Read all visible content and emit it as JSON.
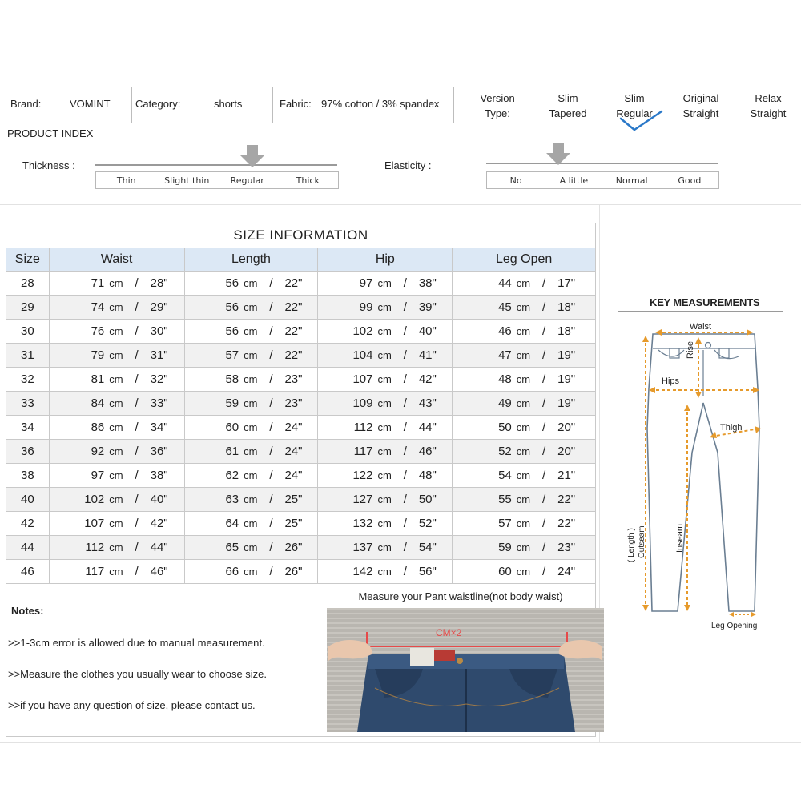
{
  "header": {
    "brand_label": "Brand:",
    "brand_value": "VOMINT",
    "category_label": "Category:",
    "category_value": "shorts",
    "fabric_label": "Fabric:",
    "fabric_value": "97% cotton / 3% spandex",
    "version_label_1": "Version",
    "version_label_2": "Type:",
    "versions": [
      {
        "line1": "Slim",
        "line2": "Tapered"
      },
      {
        "line1": "Slim",
        "line2": "Regular"
      },
      {
        "line1": "Original",
        "line2": "Straight"
      },
      {
        "line1": "Relax",
        "line2": "Straight"
      }
    ],
    "selected_version": "Slim Regular"
  },
  "product_index": {
    "title": "PRODUCT INDEX",
    "thickness_label": "Thickness :",
    "thickness_options": [
      "Thin",
      "Slight thin",
      "Regular",
      "Thick"
    ],
    "thickness_selected": "Regular",
    "elasticity_label": "Elasticity :",
    "elasticity_options": [
      "No",
      "A little",
      "Normal",
      "Good"
    ],
    "elasticity_selected": "A little"
  },
  "size_table": {
    "title": "SIZE  INFORMATION",
    "columns": [
      "Size",
      "Waist",
      "Length",
      "Hip",
      "Leg Open"
    ],
    "rows": [
      {
        "size": "28",
        "waist_cm": "71",
        "waist_in": "28\"",
        "length_cm": "56",
        "length_in": "22\"",
        "hip_cm": "97",
        "hip_in": "38\"",
        "leg_cm": "44",
        "leg_in": "17\""
      },
      {
        "size": "29",
        "waist_cm": "74",
        "waist_in": "29\"",
        "length_cm": "56",
        "length_in": "22\"",
        "hip_cm": "99",
        "hip_in": "39\"",
        "leg_cm": "45",
        "leg_in": "18\""
      },
      {
        "size": "30",
        "waist_cm": "76",
        "waist_in": "30\"",
        "length_cm": "56",
        "length_in": "22\"",
        "hip_cm": "102",
        "hip_in": "40\"",
        "leg_cm": "46",
        "leg_in": "18\""
      },
      {
        "size": "31",
        "waist_cm": "79",
        "waist_in": "31\"",
        "length_cm": "57",
        "length_in": "22\"",
        "hip_cm": "104",
        "hip_in": "41\"",
        "leg_cm": "47",
        "leg_in": "19\""
      },
      {
        "size": "32",
        "waist_cm": "81",
        "waist_in": "32\"",
        "length_cm": "58",
        "length_in": "23\"",
        "hip_cm": "107",
        "hip_in": "42\"",
        "leg_cm": "48",
        "leg_in": "19\""
      },
      {
        "size": "33",
        "waist_cm": "84",
        "waist_in": "33\"",
        "length_cm": "59",
        "length_in": "23\"",
        "hip_cm": "109",
        "hip_in": "43\"",
        "leg_cm": "49",
        "leg_in": "19\""
      },
      {
        "size": "34",
        "waist_cm": "86",
        "waist_in": "34\"",
        "length_cm": "60",
        "length_in": "24\"",
        "hip_cm": "112",
        "hip_in": "44\"",
        "leg_cm": "50",
        "leg_in": "20\""
      },
      {
        "size": "36",
        "waist_cm": "92",
        "waist_in": "36\"",
        "length_cm": "61",
        "length_in": "24\"",
        "hip_cm": "117",
        "hip_in": "46\"",
        "leg_cm": "52",
        "leg_in": "20\""
      },
      {
        "size": "38",
        "waist_cm": "97",
        "waist_in": "38\"",
        "length_cm": "62",
        "length_in": "24\"",
        "hip_cm": "122",
        "hip_in": "48\"",
        "leg_cm": "54",
        "leg_in": "21\""
      },
      {
        "size": "40",
        "waist_cm": "102",
        "waist_in": "40\"",
        "length_cm": "63",
        "length_in": "25\"",
        "hip_cm": "127",
        "hip_in": "50\"",
        "leg_cm": "55",
        "leg_in": "22\""
      },
      {
        "size": "42",
        "waist_cm": "107",
        "waist_in": "42\"",
        "length_cm": "64",
        "length_in": "25\"",
        "hip_cm": "132",
        "hip_in": "52\"",
        "leg_cm": "57",
        "leg_in": "22\""
      },
      {
        "size": "44",
        "waist_cm": "112",
        "waist_in": "44\"",
        "length_cm": "65",
        "length_in": "26\"",
        "hip_cm": "137",
        "hip_in": "54\"",
        "leg_cm": "59",
        "leg_in": "23\""
      },
      {
        "size": "46",
        "waist_cm": "117",
        "waist_in": "46\"",
        "length_cm": "66",
        "length_in": "26\"",
        "hip_cm": "142",
        "hip_in": "56\"",
        "leg_cm": "60",
        "leg_in": "24\""
      }
    ],
    "unit": "cm",
    "separator": "/"
  },
  "notes": {
    "title": "Notes:",
    "items": [
      ">>1-3cm error is allowed due to manual measurement.",
      ">>Measure the clothes you usually wear to choose size.",
      ">>if you have any question of size, please contact us."
    ]
  },
  "waistline_photo": {
    "caption": "Measure your Pant waistline(not body waist)",
    "measure_label": "CM×2"
  },
  "key_measurements": {
    "title": "KEY MEASUREMENTS",
    "labels": {
      "waist": "Waist",
      "rise": "Rise",
      "hips": "Hips",
      "thigh": "Thigh",
      "length": "( Length )",
      "outseam": "Outseam",
      "inseam": "Inseam",
      "leg_opening": "Leg Opening"
    }
  },
  "colors": {
    "header_fill": "#dce8f5",
    "accent_blue": "#2a78c8",
    "measure_orange": "#e69a2b",
    "arrow_gray": "#a6a6a6"
  }
}
